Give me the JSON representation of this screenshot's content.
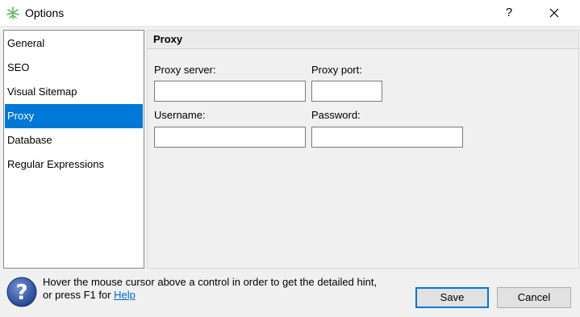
{
  "window": {
    "title": "Options",
    "help_glyph": "?",
    "close_icon": "close-icon",
    "app_icon": "app-icon"
  },
  "categories": [
    {
      "label": "General",
      "selected": false
    },
    {
      "label": "SEO",
      "selected": false
    },
    {
      "label": "Visual Sitemap",
      "selected": false
    },
    {
      "label": "Proxy",
      "selected": true
    },
    {
      "label": "Database",
      "selected": false
    },
    {
      "label": "Regular Expressions",
      "selected": false
    }
  ],
  "panel": {
    "title": "Proxy",
    "proxy_server": {
      "label": "Proxy server:",
      "value": ""
    },
    "proxy_port": {
      "label": "Proxy port:",
      "value": ""
    },
    "username": {
      "label": "Username:",
      "value": ""
    },
    "password": {
      "label": "Password:",
      "value": ""
    }
  },
  "hint": {
    "line1": "Hover the mouse cursor above a control in order to get the detailed hint,",
    "line2_prefix": "or press F1 for ",
    "link": "Help",
    "icon": "question-icon"
  },
  "buttons": {
    "save": "Save",
    "cancel": "Cancel"
  },
  "colors": {
    "selection": "#0078d7",
    "link": "#0066cc"
  }
}
